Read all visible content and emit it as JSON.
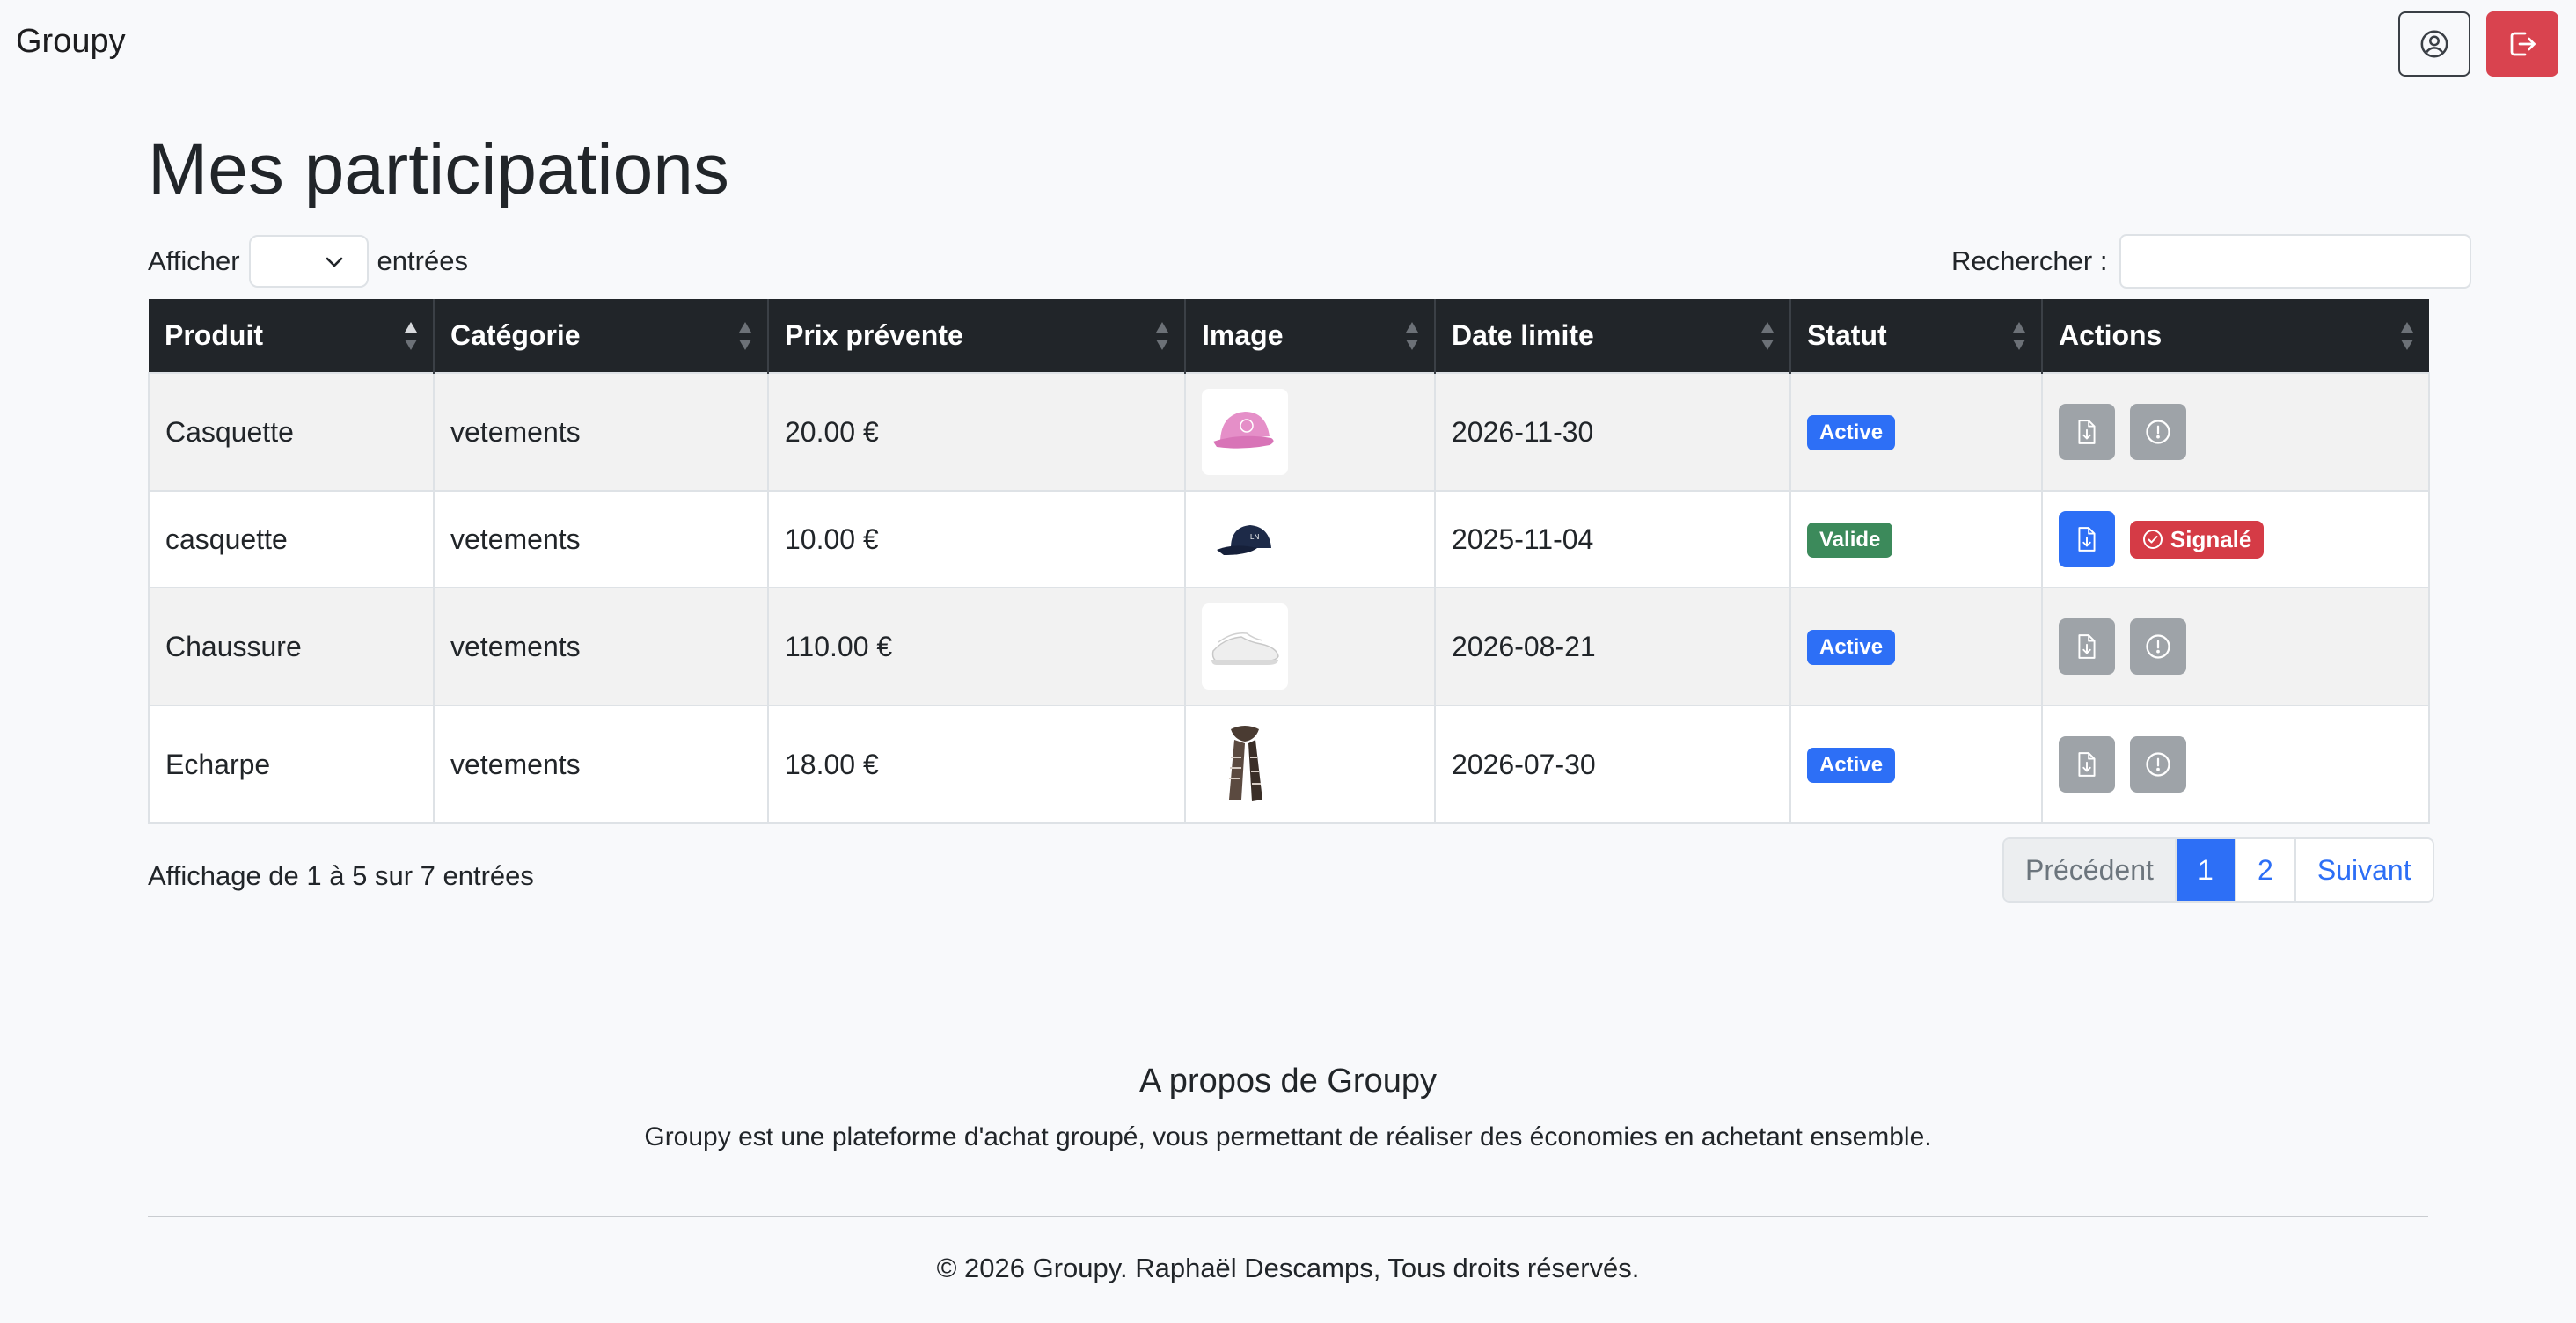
{
  "navbar": {
    "brand": "Groupy",
    "profile_icon": "user-circle-icon",
    "logout_icon": "logout-icon",
    "colors": {
      "logout": "#d9434f"
    }
  },
  "page": {
    "title": "Mes participations"
  },
  "controls": {
    "length_prefix": "Afficher",
    "length_value": "",
    "length_suffix": "entrées",
    "search_label": "Rechercher :",
    "search_value": ""
  },
  "table": {
    "headers": [
      "Produit",
      "Catégorie",
      "Prix prévente",
      "Image",
      "Date limite",
      "Statut",
      "Actions"
    ],
    "rows": [
      {
        "produit": "Casquette",
        "categorie": "vetements",
        "prix": "20.00 €",
        "image": "pink-cap",
        "date": "2026-11-30",
        "statut": "Active",
        "actions": "disabled"
      },
      {
        "produit": "casquette",
        "categorie": "vetements",
        "prix": "10.00 €",
        "image": "navy-cap",
        "date": "2025-11-04",
        "statut": "Valide",
        "actions": "signaled",
        "signal_label": "Signalé"
      },
      {
        "produit": "Chaussure",
        "categorie": "vetements",
        "prix": "110.00 €",
        "image": "white-sneaker",
        "date": "2026-08-21",
        "statut": "Active",
        "actions": "disabled"
      },
      {
        "produit": "Echarpe",
        "categorie": "vetements",
        "prix": "18.00 €",
        "image": "striped-scarf",
        "date": "2026-07-30",
        "statut": "Active",
        "actions": "disabled"
      }
    ],
    "colors": {
      "header_bg": "#212529",
      "badge_active": "#2d6ff6",
      "badge_valid": "#3c8a5b",
      "signal": "#d53b46"
    }
  },
  "footer_info": {
    "text": "Affichage de 1 à 5 sur 7 entrées"
  },
  "pagination": {
    "prev": "Précédent",
    "pages": [
      "1",
      "2"
    ],
    "current": "1",
    "next": "Suivant"
  },
  "about": {
    "title": "A propos de Groupy",
    "text": "Groupy est une plateforme d'achat groupé, vous permettant de réaliser des économies en achetant ensemble."
  },
  "copyright": "© 2026 Groupy. Raphaël Descamps, Tous droits réservés."
}
